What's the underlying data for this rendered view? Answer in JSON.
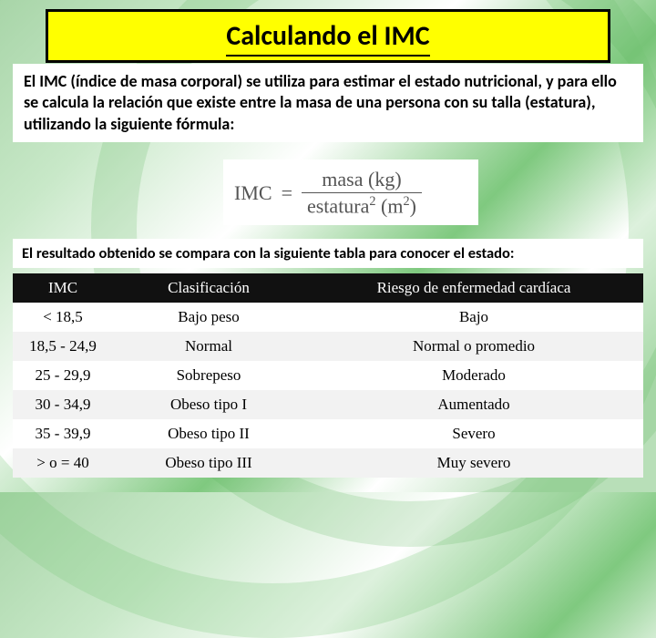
{
  "title": "Calculando el IMC",
  "description": "El IMC (índice de masa corporal) se utiliza para estimar el estado nutricional, y para ello se calcula la relación que existe entre la masa de una persona con su talla (estatura), utilizando la siguiente fórmula:",
  "formula": {
    "lhs": "IMC",
    "eq": "=",
    "num": "masa (kg)",
    "den_base": "estatura",
    "den_exp": "2",
    "den_unit_base": "(m",
    "den_unit_exp": "2",
    "den_unit_close": ")"
  },
  "compare_text": "El resultado obtenido se  compara con la siguiente tabla para conocer el estado:",
  "table": {
    "headers": {
      "imc": "IMC",
      "clas": "Clasificación",
      "risk": "Riesgo de enfermedad cardíaca"
    },
    "rows": [
      {
        "imc": "< 18,5",
        "clas": "Bajo peso",
        "risk": "Bajo"
      },
      {
        "imc": "18,5 - 24,9",
        "clas": "Normal",
        "risk": "Normal o promedio"
      },
      {
        "imc": "25 - 29,9",
        "clas": "Sobrepeso",
        "risk": "Moderado"
      },
      {
        "imc": "30 - 34,9",
        "clas": "Obeso tipo I",
        "risk": "Aumentado"
      },
      {
        "imc": "35 - 39,9",
        "clas": "Obeso tipo II",
        "risk": "Severo"
      },
      {
        "imc": "> o = 40",
        "clas": "Obeso tipo III",
        "risk": "Muy severo"
      }
    ]
  }
}
